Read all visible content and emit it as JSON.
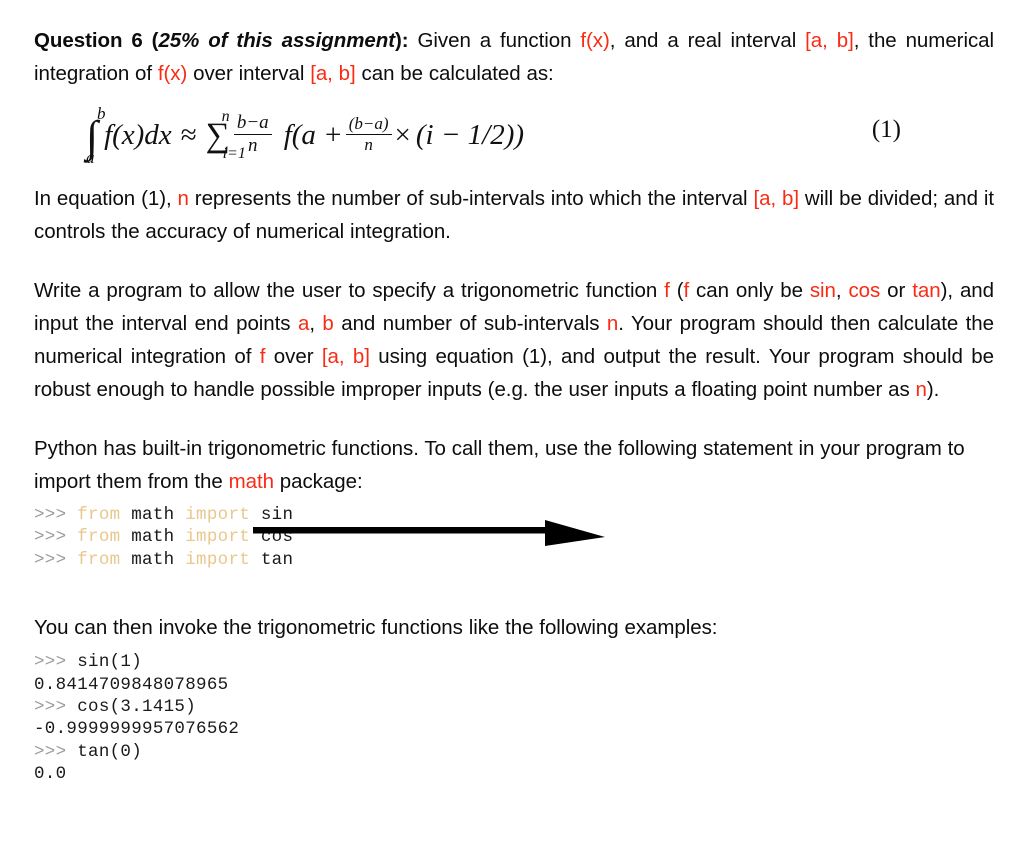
{
  "document": {
    "question_label": "Question 6 (",
    "question_weight": "25% of this assignment",
    "question_label_end": "):",
    "intro_p1_a": " Given a function ",
    "intro_p1_fx1": "f(x)",
    "intro_p1_b": ", and a real interval ",
    "intro_p1_ab1": "[a, b]",
    "intro_p1_c": ", the numerical integration of ",
    "intro_p1_fx2": "f(x)",
    "intro_p1_d": " over interval ",
    "intro_p1_ab2": "[a, b]",
    "intro_p1_e": " can be calculated as:"
  },
  "equation": {
    "number": "(1)",
    "integral_symbol": "∫",
    "integral_upper": "b",
    "integral_lower": "a",
    "integrand": "f(x)dx",
    "approx_symbol": "≈",
    "sum_symbol": "∑",
    "sum_upper": "n",
    "sum_lower": "i=1",
    "frac1_num": "b−a",
    "frac1_den": "n",
    "f_open": "f(a +",
    "frac2_num": "(b−a)",
    "frac2_den": "n",
    "times_symbol": "×",
    "tail": "(i − 1/2))",
    "latex": "\\int_a^b f(x)dx \\approx \\sum_{i=1}^{n} \\frac{b-a}{n} f\\left(a + \\frac{(b-a)}{n} \\times (i - 1/2)\\right)"
  },
  "paragraph2": {
    "a": "In equation (1), ",
    "n1": "n",
    "b": " represents the number of sub-intervals into which the interval ",
    "ab": "[a, b]",
    "c": " will be divided; and it controls the accuracy of numerical integration."
  },
  "paragraph3": {
    "a": "Write a program to allow the user to specify a trigonometric function ",
    "f1": "f",
    "b": " (",
    "f2": "f",
    "c": " can only be ",
    "sin": "sin",
    "d": ", ",
    "cos": "cos",
    "e": " or ",
    "tan": "tan",
    "f": "), and input the interval end points ",
    "a_var": "a",
    "g": ", ",
    "b_var": "b",
    "h": " and number of sub-intervals ",
    "n1": "n",
    "i": ". Your program should then calculate the numerical integration of ",
    "f3": "f",
    "j": " over ",
    "ab": "[a, b]",
    "k": " using equation (1), and output the result. Your program should be robust enough to handle possible improper inputs (e.g. the user inputs a floating point number as ",
    "n2": "n",
    "l": ")."
  },
  "paragraph4": {
    "a": "Python has built-in trigonometric functions. To call them, use the following statement in your program to import them from the ",
    "math": "math",
    "b": " package:"
  },
  "code_block_1": {
    "lines": [
      {
        "prompt": ">>> ",
        "parts": [
          {
            "text": "from",
            "style": "kw"
          },
          {
            "text": " math ",
            "style": "out"
          },
          {
            "text": "import",
            "style": "kw"
          },
          {
            "text": " sin",
            "style": "out"
          }
        ]
      },
      {
        "prompt": ">>> ",
        "parts": [
          {
            "text": "from",
            "style": "kw"
          },
          {
            "text": " math ",
            "style": "out"
          },
          {
            "text": "import",
            "style": "kw"
          },
          {
            "text": " cos",
            "style": "out"
          }
        ]
      },
      {
        "prompt": ">>> ",
        "parts": [
          {
            "text": "from",
            "style": "kw"
          },
          {
            "text": " math ",
            "style": "out"
          },
          {
            "text": "import",
            "style": "kw"
          },
          {
            "text": " tan",
            "style": "out"
          }
        ]
      }
    ]
  },
  "paragraph5": {
    "text": "You can then invoke the trigonometric functions like the following examples:"
  },
  "code_block_2": {
    "lines": [
      {
        "prompt": ">>> ",
        "parts": [
          {
            "text": "sin(1)",
            "style": "out"
          }
        ]
      },
      {
        "prompt": "",
        "parts": [
          {
            "text": "0.8414709848078965",
            "style": "out"
          }
        ]
      },
      {
        "prompt": ">>> ",
        "parts": [
          {
            "text": "cos(3.1415)",
            "style": "out"
          }
        ]
      },
      {
        "prompt": "",
        "parts": [
          {
            "text": "-0.9999999957076562",
            "style": "out"
          }
        ]
      },
      {
        "prompt": ">>> ",
        "parts": [
          {
            "text": "tan(0)",
            "style": "out"
          }
        ]
      },
      {
        "prompt": "",
        "parts": [
          {
            "text": "0.0",
            "style": "out"
          }
        ]
      }
    ]
  },
  "annotation": {
    "type": "arrow",
    "direction": "right",
    "color": "#000000"
  },
  "colors": {
    "highlight_red": "#FA2A14",
    "code_keyword": "#E8C88C",
    "code_prompt": "#9A9A9A",
    "text": "#0D0D0D",
    "background": "#FFFFFF"
  }
}
